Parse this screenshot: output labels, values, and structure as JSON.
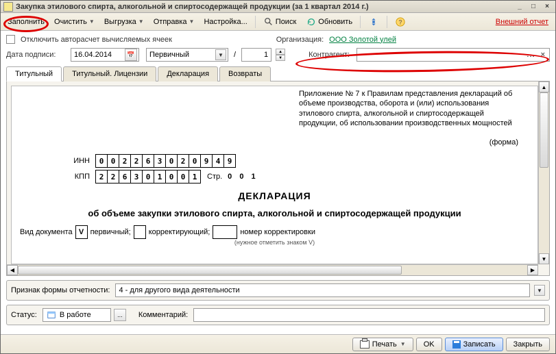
{
  "window": {
    "title": "Закупка этилового спирта, алкогольной и спиртосодержащей продукции (за 1 квартал 2014 г.)"
  },
  "toolbar": {
    "fill": "Заполнить",
    "clear": "Очистить",
    "export": "Выгрузка",
    "send": "Отправка",
    "settings": "Настройка...",
    "search": "Поиск",
    "refresh": "Обновить",
    "external_report": "Внешний отчет"
  },
  "options": {
    "autocalc_label": "Отключить авторасчет вычисляемых ячеек",
    "org_label": "Организация:",
    "org_value": "ООО Золотой улей",
    "sign_date_label": "Дата подписи:",
    "sign_date_value": "16.04.2014",
    "doc_kind": "Первичный",
    "separator": "/",
    "seq_no": "1",
    "counterparty_label": "Контрагент:",
    "counterparty_value": ""
  },
  "tabs": [
    {
      "label": "Титульный"
    },
    {
      "label": "Титульный. Лицензии"
    },
    {
      "label": "Декларация"
    },
    {
      "label": "Возвраты"
    }
  ],
  "document": {
    "note": "Приложение № 7 к Правилам представления деклараций об объеме производства, оборота и (или) использования этилового спирта, алкогольной и спиртосодержащей продукции, об использовании производственных мощностей",
    "forma": "(форма)",
    "inn_label": "ИНН",
    "inn_digits": [
      "0",
      "0",
      "2",
      "2",
      "6",
      "3",
      "0",
      "2",
      "0",
      "9",
      "4",
      "9"
    ],
    "kpp_label": "КПП",
    "kpp_digits": [
      "2",
      "2",
      "6",
      "3",
      "0",
      "1",
      "0",
      "0",
      "1"
    ],
    "page_label": "Стр.",
    "page_digits": "0  0  1",
    "title": "ДЕКЛАРАЦИЯ",
    "subtitle": "об объеме закупки этилового спирта, алкогольной и спиртосодержащей продукции",
    "doc_type_label": "Вид документа",
    "primary_mark": "V",
    "primary_label": "первичный;",
    "correct_label": "корректирующий;",
    "correct_no_label": "номер корректировки",
    "small_note": "(нужное отметить знаком V)"
  },
  "form_sign": {
    "label": "Признак формы отчетности:",
    "value": "4 - для другого вида деятельности"
  },
  "status_row": {
    "status_label": "Статус:",
    "status_value": "В работе",
    "comment_label": "Комментарий:",
    "comment_value": ""
  },
  "footer": {
    "print": "Печать",
    "ok": "OK",
    "save": "Записать",
    "close": "Закрыть"
  }
}
